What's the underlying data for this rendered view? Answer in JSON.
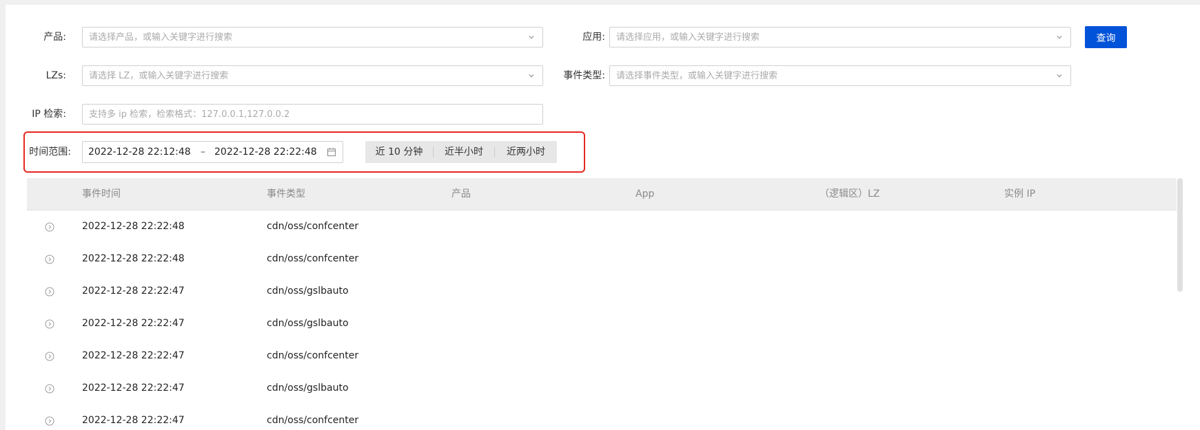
{
  "filters": {
    "product": {
      "label": "产品:",
      "placeholder": "请选择产品，或输入关键字进行搜索"
    },
    "app": {
      "label": "应用:",
      "placeholder": "请选择应用，或输入关键字进行搜索"
    },
    "lz": {
      "label": "LZs:",
      "placeholder": "请选择 LZ，或输入关键字进行搜索"
    },
    "event_type": {
      "label": "事件类型:",
      "placeholder": "请选择事件类型，或输入关键字进行搜索"
    },
    "ip": {
      "label": "IP 检索:",
      "placeholder": "支持多 ip 检索，检索格式：127.0.0.1,127.0.0.2"
    },
    "query_button": "查询"
  },
  "time_range": {
    "label": "时间范围:",
    "start": "2022-12-28 22:12:48",
    "separator": "–",
    "end": "2022-12-28 22:22:48",
    "quick_options": [
      "近 10 分钟",
      "近半小时",
      "近两小时"
    ],
    "highlight_color": "#e5261f"
  },
  "table": {
    "columns": [
      "事件时间",
      "事件类型",
      "产品",
      "App",
      "（逻辑区）LZ",
      "实例 IP"
    ],
    "rows": [
      {
        "time": "2022-12-28 22:22:48",
        "event_type": "cdn/oss/confcenter"
      },
      {
        "time": "2022-12-28 22:22:48",
        "event_type": "cdn/oss/confcenter"
      },
      {
        "time": "2022-12-28 22:22:47",
        "event_type": "cdn/oss/gslbauto"
      },
      {
        "time": "2022-12-28 22:22:47",
        "event_type": "cdn/oss/gslbauto"
      },
      {
        "time": "2022-12-28 22:22:47",
        "event_type": "cdn/oss/confcenter"
      },
      {
        "time": "2022-12-28 22:22:47",
        "event_type": "cdn/oss/gslbauto"
      },
      {
        "time": "2022-12-28 22:22:47",
        "event_type": "cdn/oss/confcenter"
      }
    ]
  },
  "colors": {
    "primary": "#0052d9",
    "header_bg": "#eeeeee"
  }
}
